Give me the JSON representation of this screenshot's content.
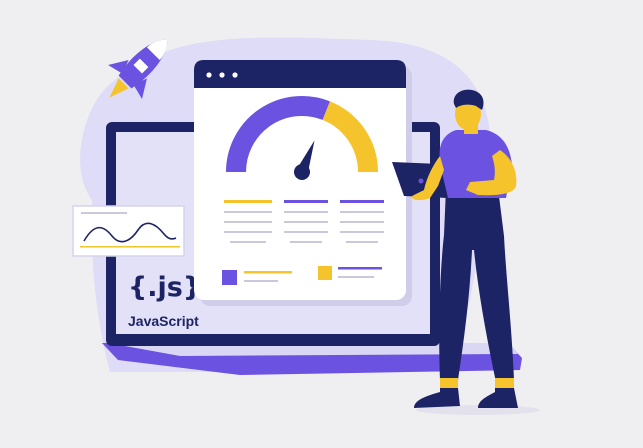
{
  "logo": {
    "mark": "{.js}",
    "caption": "JavaScript"
  },
  "icons": {
    "rocket": "rocket-icon",
    "gauge": "speedometer-gauge-icon",
    "chart": "line-chart-icon"
  },
  "gauge": {
    "value": 0.62
  },
  "colors": {
    "background": "#efeff1",
    "blob": "#dedcf6",
    "navy": "#1d2466",
    "purple": "#6b52e0",
    "yellow": "#f5c42c",
    "panel": "#ffffff",
    "grey_line": "#c9c8dd"
  }
}
